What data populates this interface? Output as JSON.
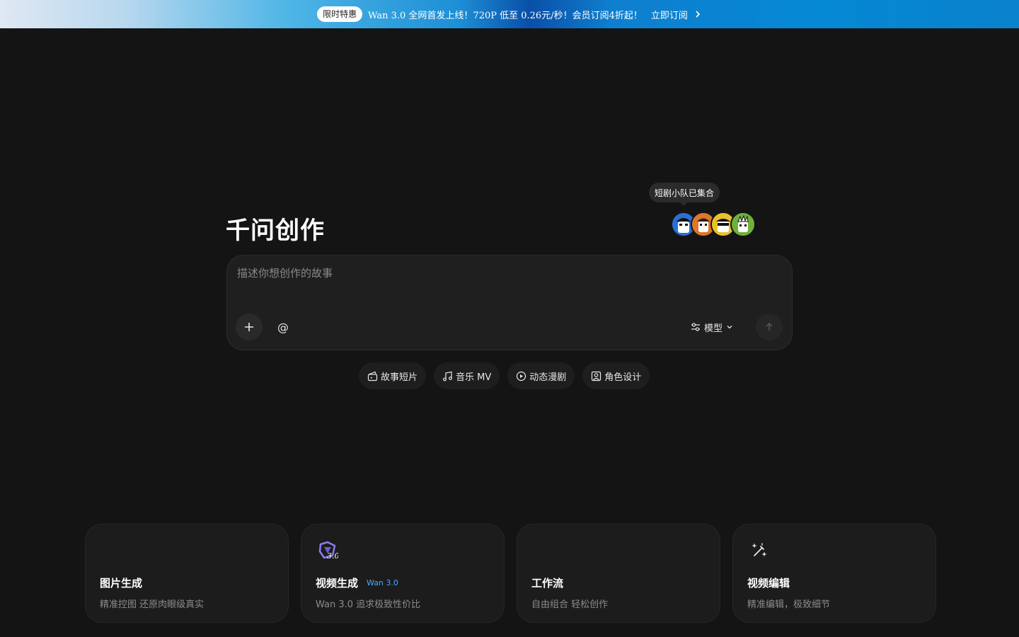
{
  "banner": {
    "badge": "限时特惠",
    "text": "Wan 3.0 全网首发上线！720P 低至 0.26元/秒！会员订阅4折起！",
    "cta": "立即订阅",
    "arrow_icon": "chevron-right-icon"
  },
  "hero": {
    "title": "千问创作",
    "tooltip": "短剧小队已集合",
    "avatars": [
      "avatar-blue",
      "avatar-orange",
      "avatar-yellow",
      "avatar-green"
    ]
  },
  "prompt": {
    "placeholder": "描述你想创作的故事",
    "value": "",
    "add_icon": "plus-icon",
    "mention_label": "@",
    "model_label": "模型",
    "model_icon": "sliders-icon",
    "send_icon": "arrow-up-icon"
  },
  "chips": [
    {
      "label": "故事短片",
      "icon": "film-clapper-icon"
    },
    {
      "label": "音乐 MV",
      "icon": "music-note-icon"
    },
    {
      "label": "动态漫剧",
      "icon": "play-circle-icon"
    },
    {
      "label": "角色设计",
      "icon": "portrait-icon"
    }
  ],
  "cards": [
    {
      "title": "图片生成",
      "tag": "",
      "desc": "精准控图 还原肉眼级真实",
      "icon": ""
    },
    {
      "title": "视频生成",
      "tag": "Wan 3.0",
      "desc": "Wan 3.0 追求极致性价比",
      "icon": "wan-3-logo-icon"
    },
    {
      "title": "工作流",
      "tag": "",
      "desc": "自由组合 轻松创作",
      "icon": ""
    },
    {
      "title": "视频编辑",
      "tag": "",
      "desc": "精准编辑，极致细节",
      "icon": "magic-wand-icon"
    }
  ],
  "colors": {
    "background": "#141414",
    "accent_tag": "#4aa8ff",
    "card_bg": "#1c1c1c"
  }
}
